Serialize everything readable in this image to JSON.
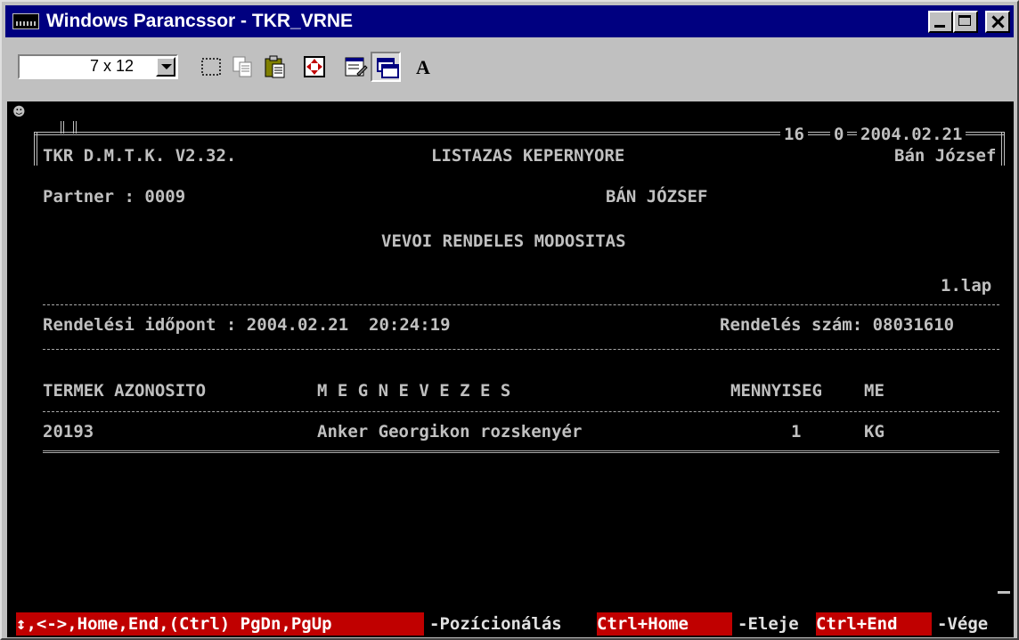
{
  "window": {
    "title": "Windows Parancssor - TKR_VRNE",
    "minimize_icon": "minimize-icon",
    "maximize_icon": "maximize-icon",
    "close_icon": "close-icon"
  },
  "toolbar": {
    "font_size_value": "7 x 12",
    "buttons": [
      "mark-icon",
      "copy-icon",
      "paste-icon",
      "fullscreen-icon",
      "properties-icon",
      "background-icon",
      "font-icon"
    ],
    "font_button_label": "A"
  },
  "console": {
    "header": {
      "app": "TKR D.M.T.K. V2.32.",
      "screen_title": "LISTAZAS KEPERNYORE",
      "number_1": "16",
      "number_2": "0",
      "date": "2004.02.21",
      "user": "Bán József"
    },
    "partner_label": "Partner : 0009",
    "partner_name": "BÁN JÓZSEF",
    "report_title": "VEVOI RENDELES MODOSITAS",
    "page": "1.lap",
    "order_time": "Rendelési időpont : 2004.02.21  20:24:19",
    "order_number": "Rendelés szám: 08031610",
    "columns": {
      "id": "TERMEK AZONOSITO",
      "name": "M E G N E V E Z E S",
      "qty": "MENNYISEG",
      "unit": "ME"
    },
    "rows": [
      {
        "id": "20193",
        "name": "Anker Georgikon rozskenyér",
        "qty": "1",
        "unit": "KG"
      }
    ]
  },
  "statusbar": {
    "keys1": "↕,<->,Home,End,(Ctrl) PgDn,PgUp",
    "desc1": "-Pozícionálás",
    "keys2": "Ctrl+Home",
    "desc2": "-Eleje",
    "keys3": "Ctrl+End",
    "desc3": "-Vége"
  },
  "colors": {
    "titlebar": "#000080",
    "console_bg": "#000000",
    "console_text": "#c0c0c0",
    "status_key_bg": "#c00000"
  }
}
